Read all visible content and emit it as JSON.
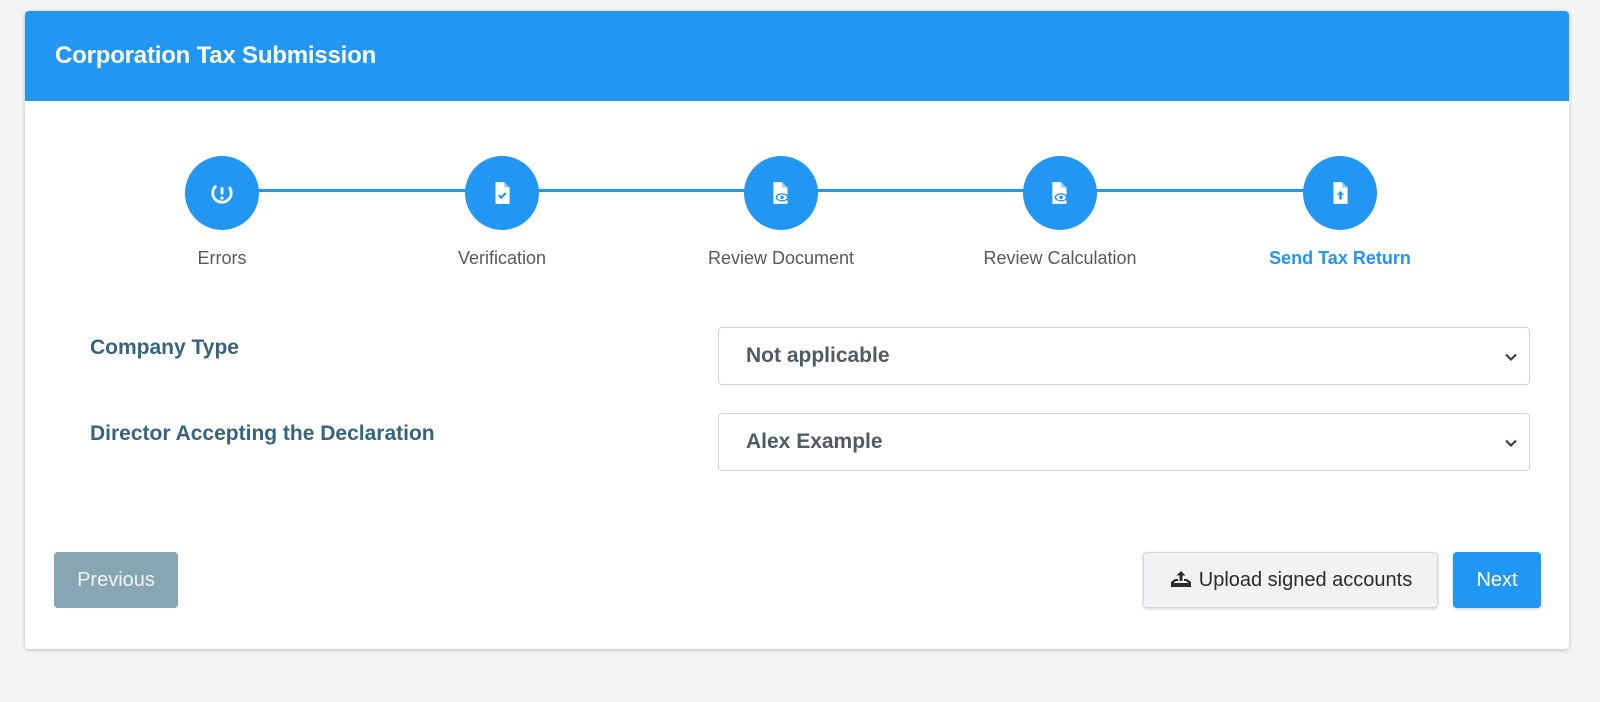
{
  "header": {
    "title": "Corporation Tax Submission"
  },
  "steps": [
    {
      "label": "Errors",
      "icon": "error-clock-icon"
    },
    {
      "label": "Verification",
      "icon": "file-check-icon"
    },
    {
      "label": "Review Document",
      "icon": "file-eye-icon"
    },
    {
      "label": "Review Calculation",
      "icon": "file-eye-icon"
    },
    {
      "label": "Send Tax Return",
      "icon": "file-upload-icon",
      "active": true
    }
  ],
  "form": {
    "company_type": {
      "label": "Company Type",
      "value": "Not applicable"
    },
    "director": {
      "label": "Director Accepting the Declaration",
      "value": "Alex Example"
    }
  },
  "buttons": {
    "previous": "Previous",
    "upload": "Upload signed accounts",
    "next": "Next"
  },
  "colors": {
    "primary": "#2196f3",
    "label": "#34647e",
    "previous_bg": "#88a5b4"
  }
}
